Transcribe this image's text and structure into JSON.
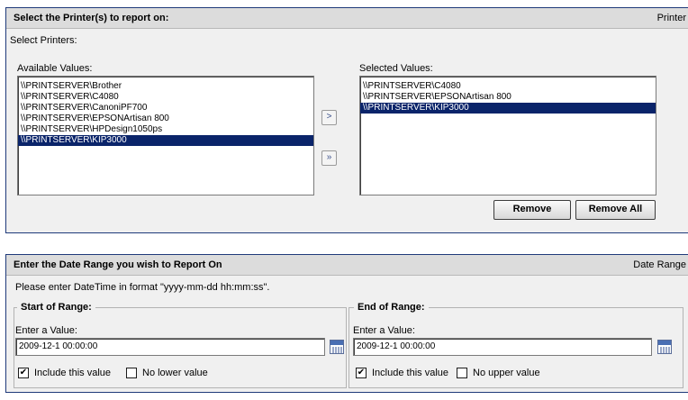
{
  "printer_panel": {
    "title": "Select the Printer(s) to report on:",
    "right_label": "Printer",
    "select_label": "Select Printers:",
    "available_label": "Available Values:",
    "selected_label": "Selected Values:",
    "available_values": [
      "\\\\PRINTSERVER\\Brother",
      "\\\\PRINTSERVER\\C4080",
      "\\\\PRINTSERVER\\CanoniPF700",
      "\\\\PRINTSERVER\\EPSONArtisan 800",
      "\\\\PRINTSERVER\\HPDesign1050ps",
      "\\\\PRINTSERVER\\KIP3000"
    ],
    "available_selected_index": 5,
    "selected_values": [
      "\\\\PRINTSERVER\\C4080",
      "\\\\PRINTSERVER\\EPSONArtisan 800",
      "\\\\PRINTSERVER\\KIP3000"
    ],
    "selected_selected_index": 2,
    "add_glyph": ">",
    "add_all_glyph": "»",
    "remove_label": "Remove",
    "remove_all_label": "Remove All"
  },
  "date_panel": {
    "title": "Enter the Date Range you wish to Report On",
    "right_label": "Date Range",
    "format_note": "Please enter DateTime in format \"yyyy-mm-dd hh:mm:ss\".",
    "start": {
      "legend": "Start of Range:",
      "enter_label": "Enter a Value:",
      "value": "2009-12-1 00:00:00",
      "include_label": "Include this value",
      "include_checked": true,
      "bound_label": "No lower value",
      "bound_checked": false
    },
    "end": {
      "legend": "End of Range:",
      "enter_label": "Enter a Value:",
      "value": "2009-12-1 00:00:00",
      "include_label": "Include this value",
      "include_checked": true,
      "bound_label": "No upper value",
      "bound_checked": false
    }
  },
  "icons": {
    "calendar": "calendar-icon",
    "check": "✔"
  }
}
